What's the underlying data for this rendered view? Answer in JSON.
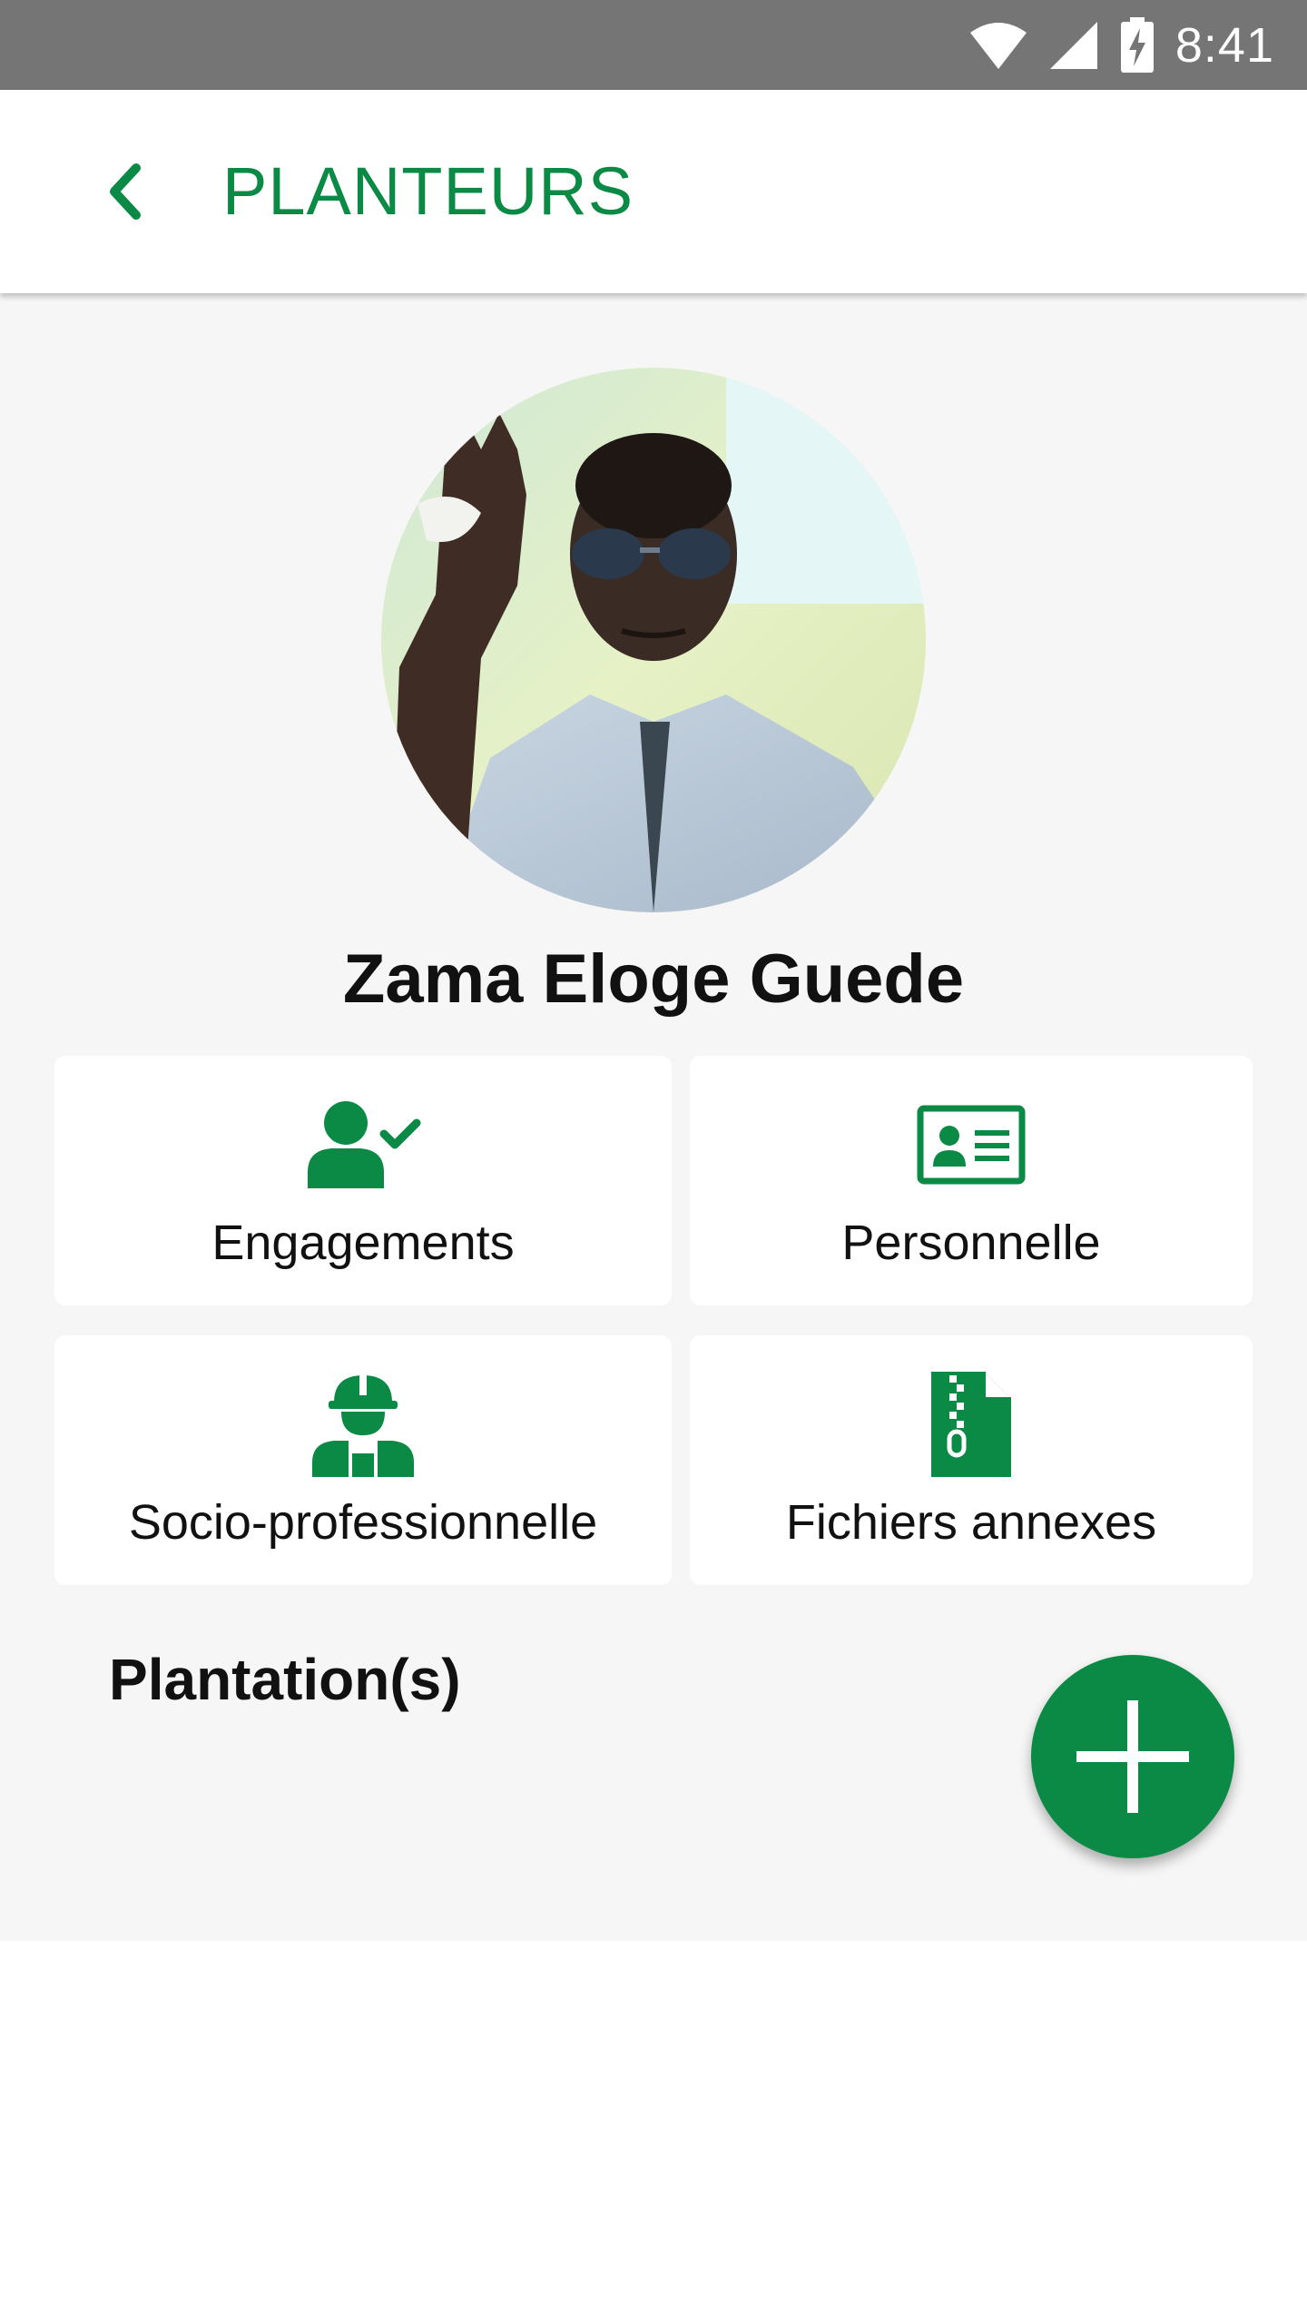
{
  "status_bar": {
    "time": "8:41",
    "icons": [
      "wifi-icon",
      "signal-icon",
      "battery-charging-icon"
    ]
  },
  "app_bar": {
    "title": "PLANTEURS",
    "back_icon": "chevron-left-icon"
  },
  "profile": {
    "name": "Zama Eloge Guede",
    "photo": "profile-photo"
  },
  "cards": [
    {
      "label": "Engagements",
      "icon": "user-check-icon"
    },
    {
      "label": "Personnelle",
      "icon": "id-card-icon"
    },
    {
      "label": "Socio-professionnelle",
      "icon": "worker-icon"
    },
    {
      "label": "Fichiers annexes",
      "icon": "zip-file-icon"
    }
  ],
  "plantations": {
    "title": "Plantation(s)",
    "add_icon": "plus-icon"
  },
  "colors": {
    "accent": "#0a8a45",
    "status_bar": "#757575",
    "background": "#f6f6f6"
  }
}
